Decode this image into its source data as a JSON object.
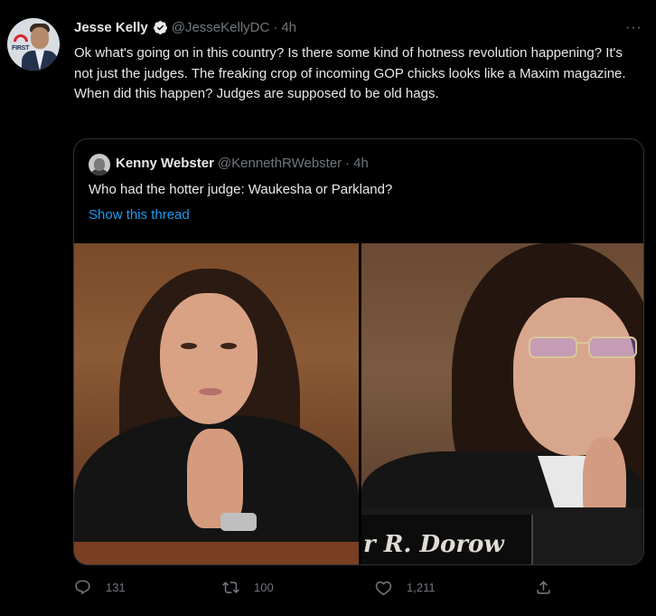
{
  "tweet": {
    "author_name": "Jesse Kelly",
    "author_handle": "@JesseKellyDC",
    "separator": "·",
    "time": "4h",
    "more": "···",
    "avatar_logo_text": "FIRST",
    "text": "Ok what's going on in this country? Is there some kind of hotness revolution happening? It's not just the judges. The freaking crop of incoming GOP chicks looks like a Maxim magazine. When did this happen? Judges are supposed to be old hags."
  },
  "quote": {
    "author_name": "Kenny Webster",
    "author_handle": "@KennethRWebster",
    "separator": "·",
    "time": "4h",
    "text": "Who had the hotter judge: Waukesha or Parkland?",
    "link": "Show this thread",
    "photo_right_nameplate": "r R. Dorow"
  },
  "actions": {
    "reply_count": "131",
    "retweet_count": "100",
    "like_count": "1,211"
  },
  "icons": {
    "verified": "verified-badge-icon",
    "reply": "reply-icon",
    "retweet": "retweet-icon",
    "like": "heart-icon",
    "share": "share-icon"
  },
  "colors": {
    "background": "#000000",
    "text": "#e7e9ea",
    "muted": "#71767b",
    "link": "#1d9bf0",
    "border": "#2f3336"
  }
}
